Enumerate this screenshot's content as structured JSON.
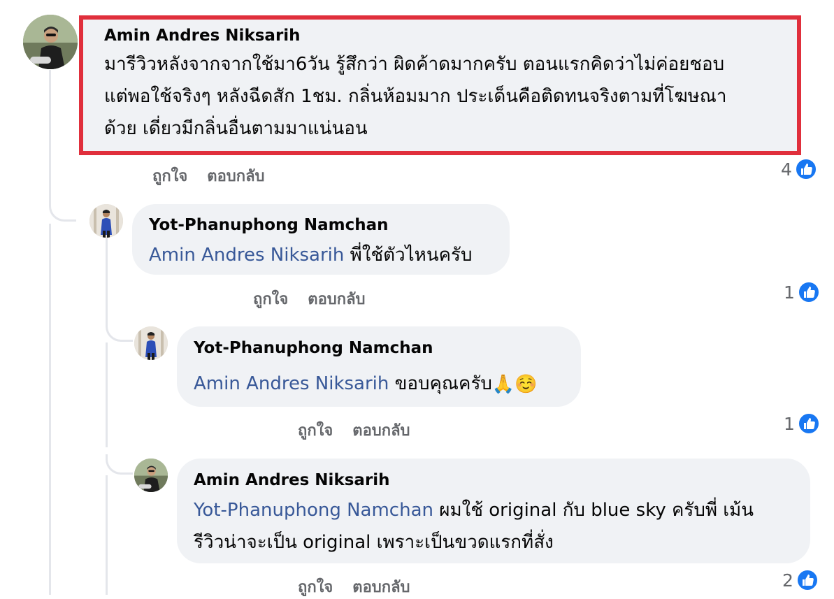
{
  "comments": [
    {
      "author": "Amin Andres Niksarih",
      "mention": "",
      "text_lines": [
        "มารีวิวหลังจากจากใช้มา6วัน รู้สึกว่า ผิดค้าดมากครับ ตอนแรกคิดว่าไม่ค่อยชอบ",
        "แต่พอใช้จริงๆ หลังฉีดสัก 1ชม. กลิ่นห้อมมาก ประเด็นคือติดทนจริงตามที่โฆษณา",
        "ด้วย เดี่ยวมีกลิ่นอื่นตามมาแน่นอน"
      ],
      "like_label": "ถูกใจ",
      "reply_label": "ตอบกลับ",
      "reaction_count": "4"
    },
    {
      "author": "Yot-Phanuphong Namchan",
      "mention": "Amin Andres Niksarih",
      "text": " พี่ใช้ตัวไหนครับ",
      "like_label": "ถูกใจ",
      "reply_label": "ตอบกลับ",
      "reaction_count": "1"
    },
    {
      "author": "Yot-Phanuphong Namchan",
      "mention": "Amin Andres Niksarih",
      "text": " ขอบคุณครับ",
      "emojis": [
        "🙏",
        "☺️"
      ],
      "like_label": "ถูกใจ",
      "reply_label": "ตอบกลับ",
      "reaction_count": "1"
    },
    {
      "author": "Amin Andres Niksarih",
      "mention": "Yot-Phanuphong Namchan",
      "text_line1": " ผมใช้ original กับ blue sky ครับพี่ เม้น",
      "text_line2": "รีวิวน่าจะเป็น original เพราะเป็นขวดแรกที่สั่ง",
      "like_label": "ถูกใจ",
      "reply_label": "ตอบกลับ",
      "reaction_count": "2"
    }
  ],
  "icons": {
    "reaction": "like-thumbs-up-icon",
    "avatar_amin": "avatar-amin",
    "avatar_yot": "avatar-yot"
  },
  "colors": {
    "highlight_border": "#e02f3c",
    "bubble_bg": "#f0f2f5",
    "mention": "#385898",
    "like_blue": "#1877f2",
    "secondary_text": "#65676b"
  }
}
